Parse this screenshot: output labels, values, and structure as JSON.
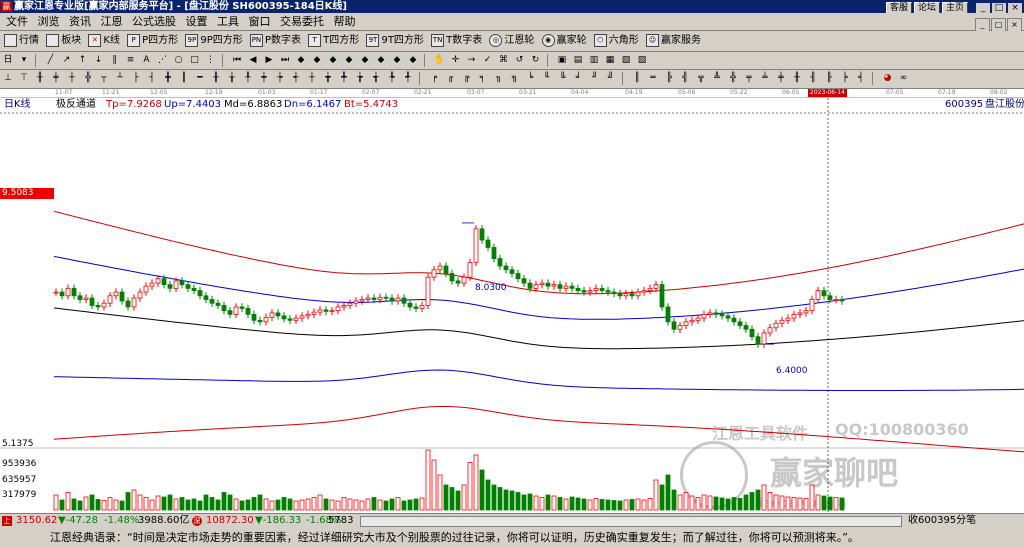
{
  "window": {
    "title": "赢家江恩专业版[赢家内部服务平台] - [盘江股份  SH600395-184日K线]",
    "right_buttons": [
      "客服",
      "论坛",
      "主页"
    ],
    "window_controls": [
      "_",
      "□",
      "×"
    ]
  },
  "menu": {
    "items": [
      "文件",
      "浏览",
      "资讯",
      "江恩",
      "公式选股",
      "设置",
      "工具",
      "窗口",
      "交易委托",
      "帮助"
    ],
    "mdi_controls": [
      "_",
      "□",
      "×"
    ]
  },
  "toolbar1": {
    "items": [
      "行情",
      "板块",
      "K线",
      "P四方形",
      "9P四方形",
      "P数字表",
      "T四方形",
      "9T四方形",
      "T数字表",
      "江恩轮",
      "赢家轮",
      "六角形",
      "赢家服务"
    ],
    "icons": [
      "grid-icon",
      "blocks-icon",
      "kline-icon",
      "P",
      "9P",
      "PN",
      "T",
      "9T",
      "TN",
      "wheel-icon",
      "wheel-icon",
      "hexagon-icon",
      "service-icon"
    ]
  },
  "dates": {
    "ticks": [
      "11-07",
      "11-21",
      "12-05",
      "12-19",
      "01-03",
      "01-17",
      "02-07",
      "02-21",
      "03-07",
      "03-21",
      "04-04",
      "04-19",
      "05-06",
      "05-22",
      "06-05",
      "07-05",
      "07-19",
      "08-02"
    ],
    "highlight": "2023-06-14"
  },
  "chart_info": {
    "period": "日K线",
    "indicator": "极反通道",
    "tp": "Tp=7.9268",
    "up": "Up=7.4403",
    "md": "Md=6.8863",
    "dn": "Dn=6.1467",
    "bt": "Bt=5.4743",
    "code": "600395",
    "name": "盘江股份",
    "price_tag": "9.5083",
    "high_label": "8.0300",
    "low_label": "6.4000",
    "price_axis_low": "5.1375",
    "vol_ticks": [
      "953936",
      "635957",
      "317979"
    ]
  },
  "watermark": {
    "line1": "江恩工具软件",
    "line2": "QQ:100800360",
    "line3": "赢家聊吧",
    "line4": "liaoba.yingjia"
  },
  "status": {
    "sh_index": "3150.62",
    "sh_change": "▼-47.28",
    "sh_pct": "-1.48%",
    "sh_amount": "3988.60亿",
    "sz_index": "10872.30",
    "sz_change": "▼-186.33",
    "sz_pct": "-1.68%",
    "sz_amount": "5783",
    "right_text": "收600395分笔"
  },
  "quote": {
    "text": "江恩经典语录：“时间是决定市场走势的重要因素，经过详细研究大市及个别股票的过往记录，你将可以证明，历史确实重复发生；而了解过往，你将可以预测将来。”。"
  },
  "colors": {
    "up_candle": "#ff0000",
    "down_candle": "#008000",
    "outer_band": "#cc0000",
    "inner_band": "#0000cc",
    "mid_band": "#000000",
    "title_bar": "#0a246a"
  },
  "chart_data": {
    "type": "candlestick",
    "title": "",
    "period": "日K线",
    "ylim": [
      5.1375,
      9.5083
    ],
    "bands": {
      "tp": 7.9268,
      "up": 7.4403,
      "md": 6.8863,
      "dn": 6.1467,
      "bt": 5.4743
    },
    "x_ticks": [
      "11-07",
      "11-21",
      "12-05",
      "12-19",
      "01-03",
      "01-17",
      "02-07",
      "02-21",
      "03-07",
      "03-21",
      "04-04",
      "04-19",
      "05-06",
      "05-22",
      "06-05",
      "07-05",
      "07-19",
      "08-02"
    ],
    "highlight_date": "2023-06-14",
    "annotations": [
      {
        "label": "8.0300",
        "value": 8.03
      },
      {
        "label": "6.4000",
        "value": 6.4
      }
    ],
    "closes": [
      7.1,
      7.05,
      7.15,
      7.05,
      7.0,
      7.02,
      6.92,
      6.9,
      6.95,
      7.05,
      7.1,
      6.98,
      6.9,
      7.02,
      7.1,
      7.18,
      7.22,
      7.28,
      7.2,
      7.15,
      7.25,
      7.2,
      7.15,
      7.12,
      7.05,
      7.0,
      6.95,
      6.92,
      6.85,
      6.8,
      6.9,
      6.88,
      6.8,
      6.72,
      6.7,
      6.76,
      6.82,
      6.78,
      6.74,
      6.72,
      6.75,
      6.78,
      6.8,
      6.83,
      6.86,
      6.84,
      6.85,
      6.9,
      6.92,
      6.95,
      6.98,
      7.0,
      7.02,
      7.0,
      7.03,
      7.02,
      6.98,
      7.02,
      6.95,
      6.9,
      6.88,
      6.92,
      7.3,
      7.4,
      7.45,
      7.35,
      7.25,
      7.22,
      7.3,
      7.5,
      7.95,
      7.8,
      7.7,
      7.55,
      7.45,
      7.4,
      7.35,
      7.28,
      7.22,
      7.15,
      7.2,
      7.22,
      7.18,
      7.2,
      7.15,
      7.18,
      7.15,
      7.12,
      7.1,
      7.12,
      7.15,
      7.12,
      7.1,
      7.08,
      7.05,
      7.08,
      7.05,
      7.1,
      7.12,
      7.15,
      7.2,
      6.9,
      6.7,
      6.6,
      6.65,
      6.7,
      6.72,
      6.75,
      6.8,
      6.82,
      6.8,
      6.78,
      6.75,
      6.7,
      6.65,
      6.6,
      6.5,
      6.4,
      6.55,
      6.62,
      6.68,
      6.72,
      6.75,
      6.8,
      6.82,
      6.85,
      7.0,
      7.12,
      7.05,
      7.0,
      7.0,
      6.98
    ],
    "volumes": [
      300,
      200,
      350,
      220,
      180,
      260,
      300,
      210,
      190,
      250,
      200,
      180,
      350,
      400,
      300,
      250,
      200,
      280,
      260,
      300,
      220,
      250,
      200,
      220,
      180,
      300,
      250,
      200,
      350,
      300,
      220,
      180,
      200,
      250,
      300,
      220,
      180,
      200,
      250,
      220,
      180,
      200,
      220,
      250,
      300,
      220,
      200,
      180,
      250,
      220,
      200,
      180,
      220,
      250,
      200,
      180,
      220,
      250,
      180,
      200,
      220,
      240,
      1200,
      1000,
      700,
      500,
      450,
      380,
      500,
      950,
      1100,
      800,
      600,
      500,
      450,
      400,
      380,
      350,
      300,
      320,
      280,
      250,
      300,
      280,
      250,
      220,
      260,
      240,
      220,
      200,
      230,
      210,
      200,
      190,
      180,
      200,
      210,
      220,
      200,
      230,
      600,
      500,
      700,
      400,
      300,
      350,
      280,
      250,
      300,
      280,
      260,
      240,
      220,
      250,
      230,
      300,
      350,
      400,
      500,
      350,
      300,
      280,
      260,
      250,
      240,
      230,
      500,
      300,
      280,
      260,
      250,
      240
    ]
  }
}
